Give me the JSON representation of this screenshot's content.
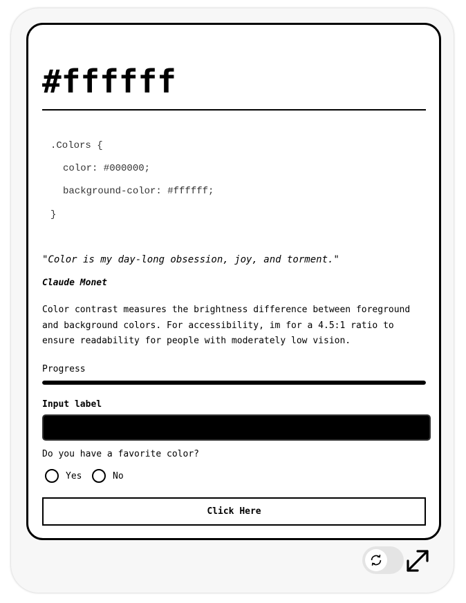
{
  "card": {
    "hex_title": "#ffffff",
    "code_lines": [
      ".Colors {",
      "color: #000000;",
      "background-color: #ffffff;",
      "}"
    ],
    "quote": "\"Color is my day-long obsession, joy, and torment.\"",
    "author": "Claude Monet",
    "description": "Color contrast measures the brightness difference between foreground and background colors. For accessibility, im for a 4.5:1 ratio to ensure readability for people with moderately low vision.",
    "progress": {
      "label": "Progress",
      "value_percent": 100
    },
    "input": {
      "label": "Input label",
      "value": "",
      "placeholder": ""
    },
    "radio": {
      "question": "Do you have a favorite color?",
      "options": [
        "Yes",
        "No"
      ]
    },
    "button_label": "Click Here"
  },
  "controls": {
    "toggle_icon": "refresh-icon",
    "expand_icon": "expand-icon"
  },
  "colors": {
    "foreground": "#000000",
    "background": "#ffffff",
    "outer_background": "#f7f7f7",
    "toggle_track": "#e4e4e4"
  }
}
